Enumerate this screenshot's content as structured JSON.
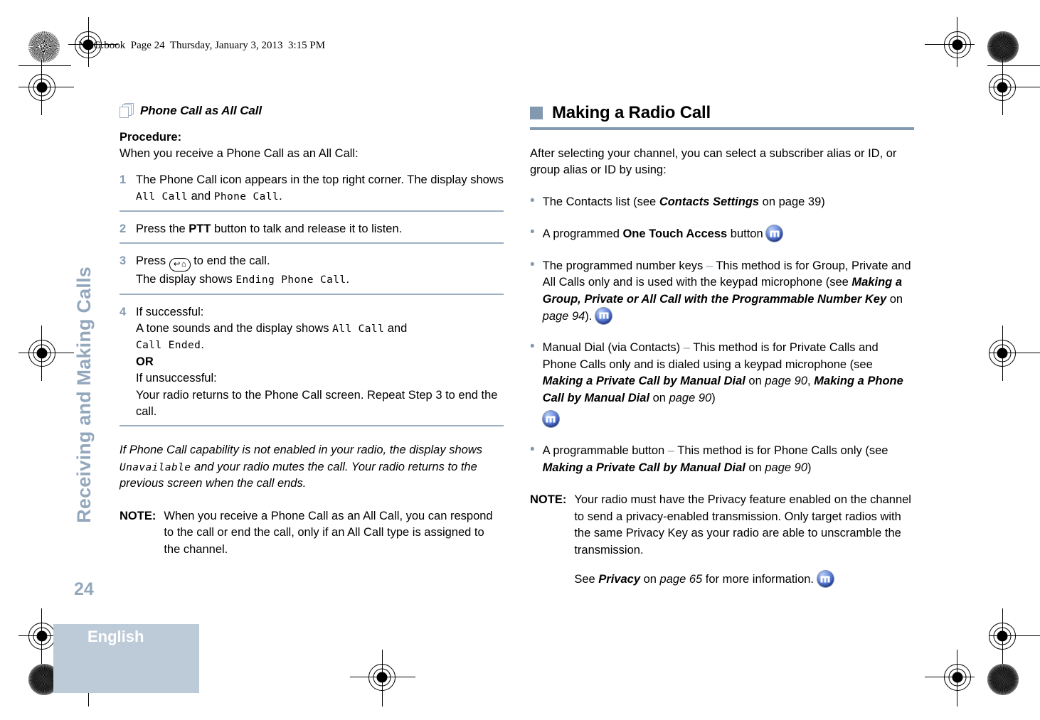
{
  "running_header": "NAG.book  Page 24  Thursday, January 3, 2013  3:15 PM",
  "accent_color": "#8299b0",
  "band_color": "#bdcbd9",
  "sidebar": {
    "chapter_title": "Receiving and Making Calls",
    "page_number": "24",
    "language": "English"
  },
  "left_column": {
    "heading": "Phone Call as All Call",
    "heading_icon": "stacked-pages-icon",
    "procedure_label": "Procedure:",
    "intro": "When you receive a Phone Call as an All Call:",
    "steps": [
      {
        "num": "1",
        "line1_a": "The Phone Call icon appears in the top right corner. The display shows ",
        "lcd1": "All Call",
        "line1_b": " and ",
        "lcd2": "Phone Call",
        "line1_c": "."
      },
      {
        "num": "2",
        "pre": "Press the ",
        "bold": "PTT",
        "post": " button to talk and release it to listen."
      },
      {
        "num": "3",
        "pre": "Press ",
        "key_icon": "home-back-key-icon",
        "post": " to end the call.",
        "line2_a": "The display shows ",
        "lcd1": "Ending Phone Call",
        "line2_b": "."
      },
      {
        "num": "4",
        "l1": "If successful:",
        "l2_a": "A tone sounds and the display shows ",
        "lcd1": "All Call",
        "l2_b": " and",
        "lcd2": "Call Ended",
        "l2_c": ".",
        "or": "OR",
        "l3": "If unsuccessful:",
        "l4": "Your radio returns to the Phone Call screen. Repeat Step 3 to end the call."
      }
    ],
    "italic_note_a": "If Phone Call capability is not enabled in your radio, the display shows ",
    "italic_note_lcd": "Unavailable",
    "italic_note_b": " and your radio mutes the call. Your radio returns to the previous screen when the call ends.",
    "note_label": "NOTE:",
    "note_text": "When you receive a Phone Call as an All Call, you can respond to the call or end the call, only if an All Call type is assigned to the channel."
  },
  "right_column": {
    "section_title": "Making a Radio Call",
    "intro": "After selecting your channel, you can select a subscriber alias or ID, or group alias or ID by using:",
    "bullets": [
      {
        "a": "The Contacts list (see ",
        "bi": "Contacts Settings",
        "b": " on page 39)",
        "icon": false
      },
      {
        "a": "A programmed ",
        "bold": "One Touch Access",
        "b": " button ",
        "icon": true,
        "icon_name": "radio-signal-icon"
      },
      {
        "a": "The programmed number keys ",
        "dash": "–",
        "b": " This method is for Group, Private and All Calls only and is used with the keypad microphone (see ",
        "bi": "Making a Group, Private or All Call with the Programmable Number Key",
        "c": " on ",
        "it": "page 94",
        "d": ").",
        "icon": true,
        "icon_name": "radio-signal-icon"
      },
      {
        "a": "Manual Dial (via Contacts) ",
        "dash": "–",
        "b": " This method is for Private Calls and Phone Calls only and is dialed using a keypad microphone (see ",
        "bi": "Making a Private Call by Manual Dial",
        "c": " on ",
        "it": "page 90",
        "d": ", ",
        "bi2": "Making a Phone Call by Manual Dial",
        "e": " on ",
        "it2": "page 90",
        "f": ")",
        "icon": true,
        "icon_name": "radio-signal-icon"
      },
      {
        "a": "A programmable button ",
        "dash": "–",
        "b": " This method is for Phone Calls only (see ",
        "bi": "Making a Private Call by Manual Dial",
        "c": " on ",
        "it": "page 90",
        "d": ")",
        "icon": false
      }
    ],
    "note_label": "NOTE:",
    "note_text": "Your radio must have the Privacy feature enabled on the channel to send a privacy-enabled transmission. Only target radios with the same Privacy Key as your radio are able to unscramble the transmission.",
    "note_see_a": "See ",
    "note_see_bi": "Privacy",
    "note_see_b": " on ",
    "note_see_it": "page 65",
    "note_see_c": " for more information. ",
    "note_icon_name": "radio-signal-icon"
  }
}
